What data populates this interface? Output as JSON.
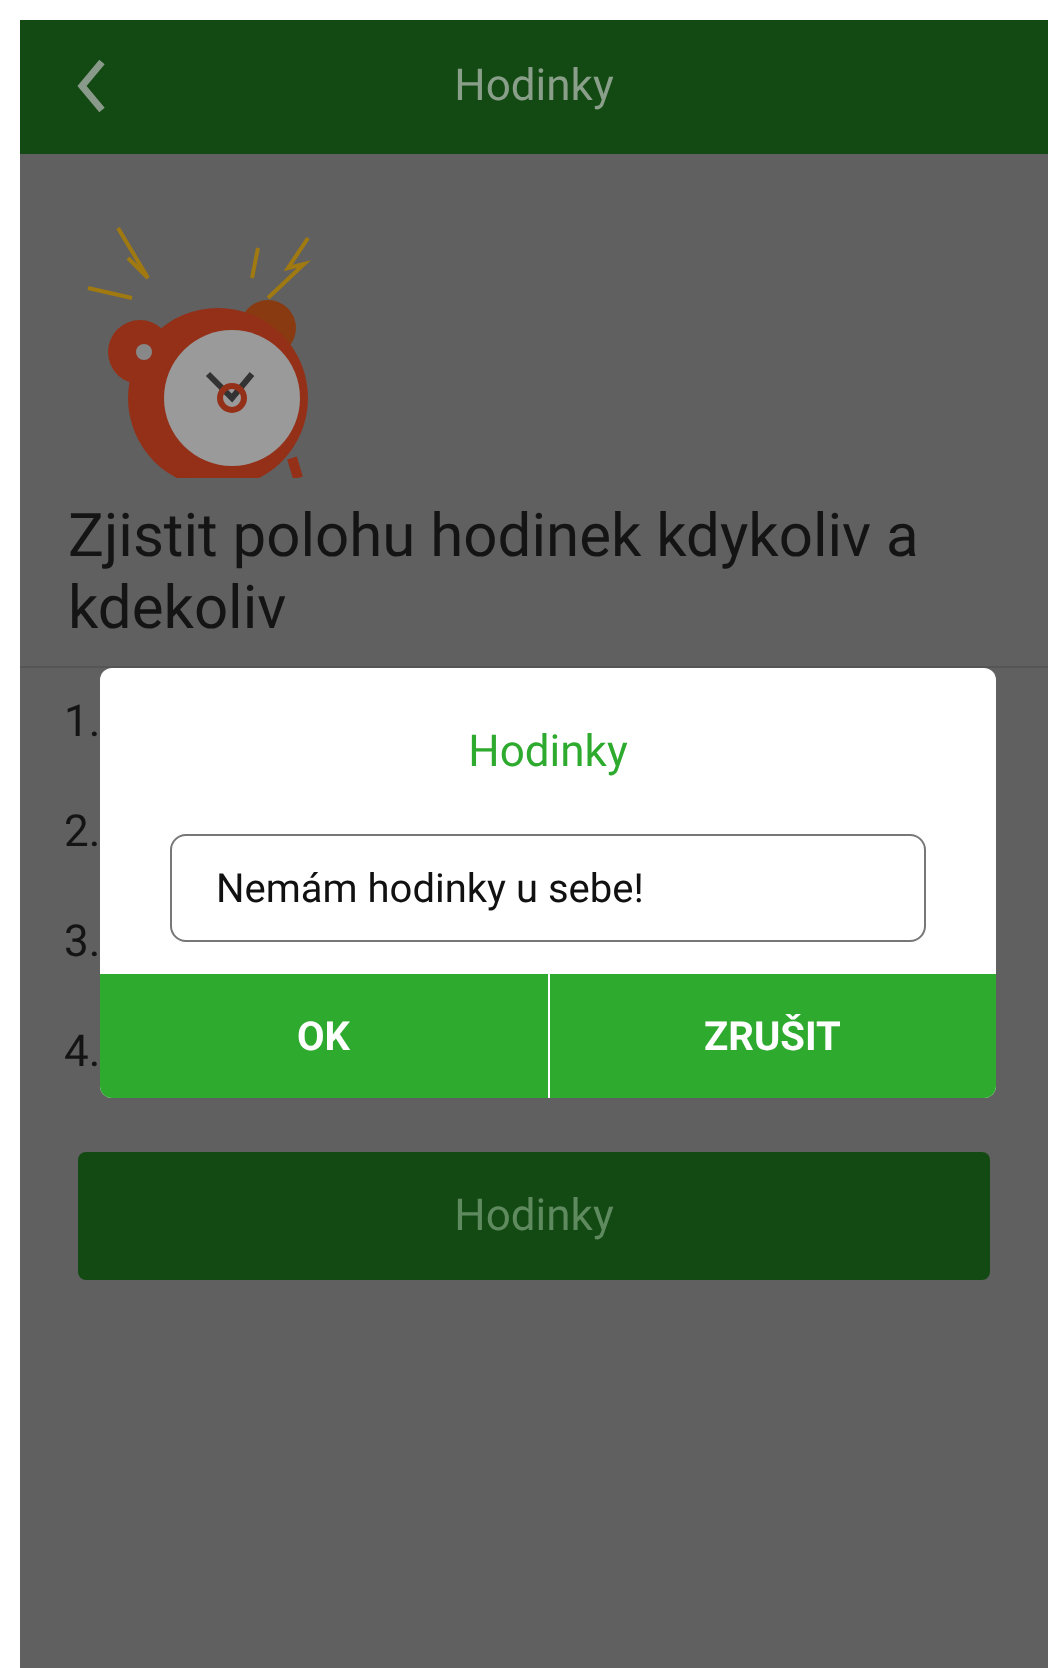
{
  "header": {
    "title": "Hodinky"
  },
  "intro": {
    "heading": "Zjistit polohu hodinek kdykoliv a kdekoliv"
  },
  "steps": [
    "1.",
    "2.",
    "3.",
    "4."
  ],
  "main_button": {
    "label": "Hodinky"
  },
  "dialog": {
    "title": "Hodinky",
    "input": {
      "value": "Nemám hodinky u sebe!"
    },
    "buttons": [
      "OK",
      "ZRUŠIT"
    ]
  }
}
